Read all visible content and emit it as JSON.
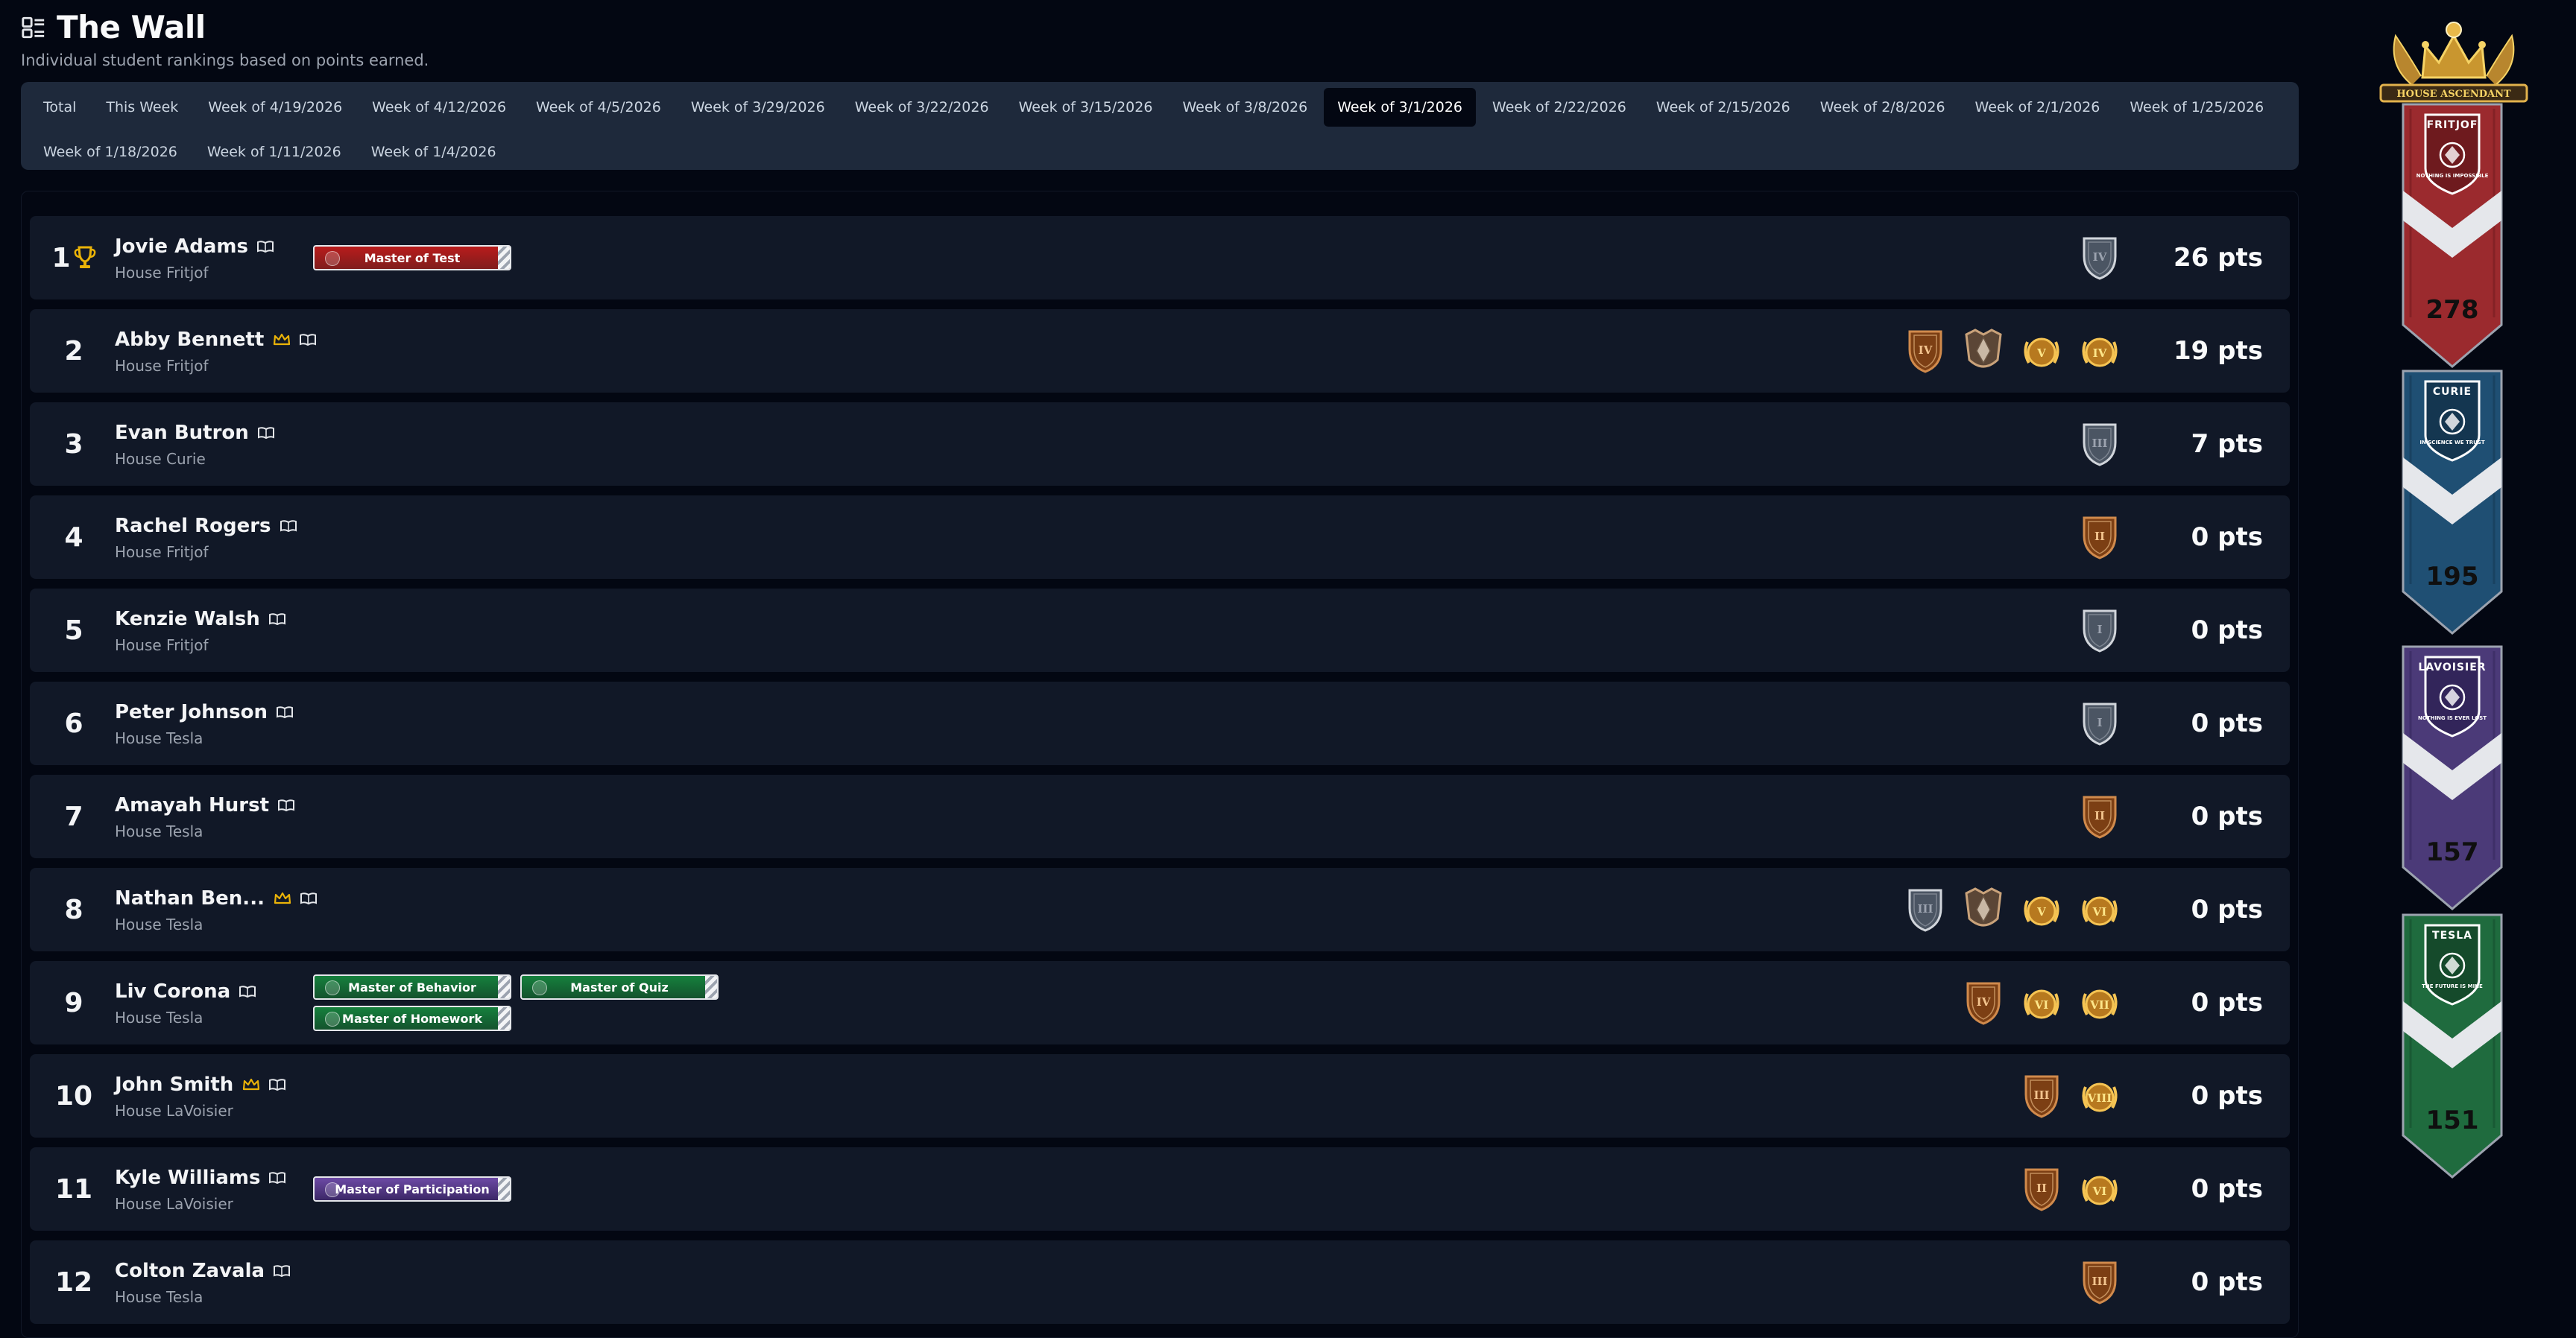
{
  "header": {
    "title": "The Wall",
    "subtitle": "Individual student rankings based on points earned.",
    "icon": "list-icon"
  },
  "tabs": [
    {
      "label": "Total",
      "active": false
    },
    {
      "label": "This Week",
      "active": false
    },
    {
      "label": "Week of 4/19/2026",
      "active": false
    },
    {
      "label": "Week of 4/12/2026",
      "active": false
    },
    {
      "label": "Week of 4/5/2026",
      "active": false
    },
    {
      "label": "Week of 3/29/2026",
      "active": false
    },
    {
      "label": "Week of 3/22/2026",
      "active": false
    },
    {
      "label": "Week of 3/15/2026",
      "active": false
    },
    {
      "label": "Week of 3/8/2026",
      "active": false
    },
    {
      "label": "Week of 3/1/2026",
      "active": true
    },
    {
      "label": "Week of 2/22/2026",
      "active": false
    },
    {
      "label": "Week of 2/15/2026",
      "active": false
    },
    {
      "label": "Week of 2/8/2026",
      "active": false
    },
    {
      "label": "Week of 2/1/2026",
      "active": false
    },
    {
      "label": "Week of 1/25/2026",
      "active": false
    },
    {
      "label": "Week of 1/18/2026",
      "active": false
    },
    {
      "label": "Week of 1/11/2026",
      "active": false
    },
    {
      "label": "Week of 1/4/2026",
      "active": false
    }
  ],
  "students": [
    {
      "rank": "1",
      "name": "Jovie Adams",
      "house": "House Fritjof",
      "crown": false,
      "trophy": true,
      "points": "26 pts",
      "titles": [
        [
          "Master of Test"
        ]
      ],
      "title_color": "red",
      "medals": [
        {
          "kind": "shield-silver",
          "numeral": "IV"
        }
      ]
    },
    {
      "rank": "2",
      "name": "Abby Bennett",
      "house": "House Fritjof",
      "crown": true,
      "trophy": false,
      "points": "19 pts",
      "titles": [],
      "title_color": "",
      "medals": [
        {
          "kind": "shield-bronze",
          "numeral": "IV"
        },
        {
          "kind": "crest-bronze",
          "numeral": ""
        },
        {
          "kind": "wreath-gold",
          "numeral": "V"
        },
        {
          "kind": "wreath-gold",
          "numeral": "IV"
        }
      ]
    },
    {
      "rank": "3",
      "name": "Evan Butron",
      "house": "House Curie",
      "crown": false,
      "trophy": false,
      "points": "7 pts",
      "titles": [],
      "title_color": "",
      "medals": [
        {
          "kind": "shield-silver",
          "numeral": "III"
        }
      ]
    },
    {
      "rank": "4",
      "name": "Rachel Rogers",
      "house": "House Fritjof",
      "crown": false,
      "trophy": false,
      "points": "0 pts",
      "titles": [],
      "title_color": "",
      "medals": [
        {
          "kind": "shield-bronze",
          "numeral": "II"
        }
      ]
    },
    {
      "rank": "5",
      "name": "Kenzie Walsh",
      "house": "House Fritjof",
      "crown": false,
      "trophy": false,
      "points": "0 pts",
      "titles": [],
      "title_color": "",
      "medals": [
        {
          "kind": "shield-silver",
          "numeral": "I"
        }
      ]
    },
    {
      "rank": "6",
      "name": "Peter Johnson",
      "house": "House Tesla",
      "crown": false,
      "trophy": false,
      "points": "0 pts",
      "titles": [],
      "title_color": "",
      "medals": [
        {
          "kind": "shield-silver",
          "numeral": "I"
        }
      ]
    },
    {
      "rank": "7",
      "name": "Amayah Hurst",
      "house": "House Tesla",
      "crown": false,
      "trophy": false,
      "points": "0 pts",
      "titles": [],
      "title_color": "",
      "medals": [
        {
          "kind": "shield-bronze",
          "numeral": "II"
        }
      ]
    },
    {
      "rank": "8",
      "name": "Nathan Ben...",
      "house": "House Tesla",
      "crown": true,
      "trophy": false,
      "points": "0 pts",
      "titles": [],
      "title_color": "",
      "medals": [
        {
          "kind": "shield-silver",
          "numeral": "III"
        },
        {
          "kind": "crest-bronze",
          "numeral": ""
        },
        {
          "kind": "wreath-gold",
          "numeral": "V"
        },
        {
          "kind": "wreath-gold",
          "numeral": "VI"
        }
      ]
    },
    {
      "rank": "9",
      "name": "Liv Corona",
      "house": "House Tesla",
      "crown": false,
      "trophy": false,
      "points": "0 pts",
      "titles": [
        [
          "Master of Behavior",
          "Master of Quiz"
        ],
        [
          "Master of Homework"
        ]
      ],
      "title_color": "green",
      "medals": [
        {
          "kind": "shield-bronze",
          "numeral": "IV"
        },
        {
          "kind": "wreath-gold",
          "numeral": "VI"
        },
        {
          "kind": "wreath-gold",
          "numeral": "VII"
        }
      ]
    },
    {
      "rank": "10",
      "name": "John Smith",
      "house": "House LaVoisier",
      "crown": true,
      "trophy": false,
      "points": "0 pts",
      "titles": [],
      "title_color": "",
      "medals": [
        {
          "kind": "shield-bronze",
          "numeral": "III"
        },
        {
          "kind": "wreath-gold",
          "numeral": "VIII"
        }
      ]
    },
    {
      "rank": "11",
      "name": "Kyle Williams",
      "house": "House LaVoisier",
      "crown": false,
      "trophy": false,
      "points": "0 pts",
      "titles": [
        [
          "Master of Participation"
        ]
      ],
      "title_color": "purple",
      "medals": [
        {
          "kind": "shield-bronze",
          "numeral": "II"
        },
        {
          "kind": "wreath-gold",
          "numeral": "VI"
        }
      ]
    },
    {
      "rank": "12",
      "name": "Colton Zavala",
      "house": "House Tesla",
      "crown": false,
      "trophy": false,
      "points": "0 pts",
      "titles": [],
      "title_color": "",
      "medals": [
        {
          "kind": "shield-bronze",
          "numeral": "III"
        }
      ]
    }
  ],
  "banners": {
    "crest_label": "HOUSE ASCENDANT",
    "houses": [
      {
        "name": "FRITJOF",
        "motto": "NOTHING IS IMPOSSIBLE",
        "score": "278",
        "color": "#9b2a2e",
        "dark": "#6e1a1e"
      },
      {
        "name": "CURIE",
        "motto": "IN SCIENCE WE TRUST",
        "score": "195",
        "color": "#1f4f73",
        "dark": "#143650"
      },
      {
        "name": "LAVOISIER",
        "motto": "NOTHING IS EVER LOST",
        "score": "157",
        "color": "#4b3a78",
        "dark": "#32255a"
      },
      {
        "name": "TESLA",
        "motto": "THE FUTURE IS MINE",
        "score": "151",
        "color": "#1f6b3e",
        "dark": "#154a2b"
      }
    ]
  }
}
